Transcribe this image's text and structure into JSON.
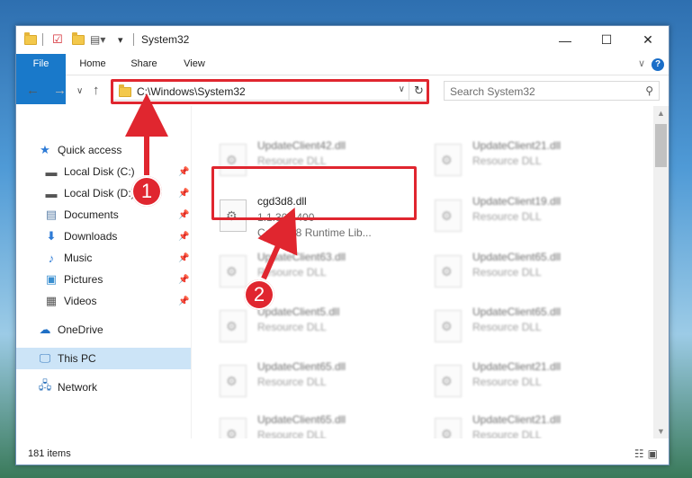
{
  "window": {
    "title": "System32",
    "controls": {
      "minimize": "—",
      "maximize": "☐",
      "close": "✕"
    }
  },
  "ribbon": {
    "tabs": [
      "File",
      "Home",
      "Share",
      "View"
    ],
    "help": "?"
  },
  "navigation": {
    "address_path": "C:\\Windows\\System32",
    "search_placeholder": "Search System32"
  },
  "sidebar": {
    "items": [
      {
        "label": "Quick access",
        "icon": "star-icon",
        "pinned": false
      },
      {
        "label": "Local Disk (C:)",
        "icon": "drive-icon",
        "pinned": true
      },
      {
        "label": "Local Disk (D:)",
        "icon": "drive-icon",
        "pinned": true
      },
      {
        "label": "Documents",
        "icon": "document-icon",
        "pinned": true
      },
      {
        "label": "Downloads",
        "icon": "download-icon",
        "pinned": true
      },
      {
        "label": "Music",
        "icon": "music-icon",
        "pinned": true
      },
      {
        "label": "Pictures",
        "icon": "pictures-icon",
        "pinned": true
      },
      {
        "label": "Videos",
        "icon": "video-icon",
        "pinned": true
      },
      {
        "label": "OneDrive",
        "icon": "cloud-icon",
        "pinned": false
      },
      {
        "label": "This PC",
        "icon": "computer-icon",
        "pinned": false,
        "selected": true
      },
      {
        "label": "Network",
        "icon": "network-icon",
        "pinned": false
      }
    ]
  },
  "files": {
    "left_column": [
      {
        "name": "UpdateClient42.dll",
        "type": "Resource DLL"
      },
      {
        "name": "cgd3d8.dll",
        "version": "1.1.303.400",
        "description": "Cg D3D8 Runtime Lib...",
        "highlighted": true
      },
      {
        "name": "UpdateClient63.dll",
        "type": "Resource DLL"
      },
      {
        "name": "UpdateClient5.dll",
        "type": "Resource DLL"
      },
      {
        "name": "UpdateClient65.dll",
        "type": "Resource DLL"
      },
      {
        "name": "UpdateClient65.dll",
        "type": "Resource DLL"
      }
    ],
    "right_column": [
      {
        "name": "UpdateClient21.dll",
        "type": "Resource DLL"
      },
      {
        "name": "UpdateClient19.dll",
        "type": "Resource DLL"
      },
      {
        "name": "UpdateClient65.dll",
        "type": "Resource DLL"
      },
      {
        "name": "UpdateClient65.dll",
        "type": "Resource DLL"
      },
      {
        "name": "UpdateClient21.dll",
        "type": "Resource DLL"
      },
      {
        "name": "UpdateClient21.dll",
        "type": "Resource DLL"
      }
    ]
  },
  "status": {
    "item_count": "181 items"
  },
  "annotations": {
    "step1": "1",
    "step2": "2"
  },
  "colors": {
    "accent": "#1979ca",
    "highlight": "#e0262f",
    "selected": "#cce4f7"
  }
}
